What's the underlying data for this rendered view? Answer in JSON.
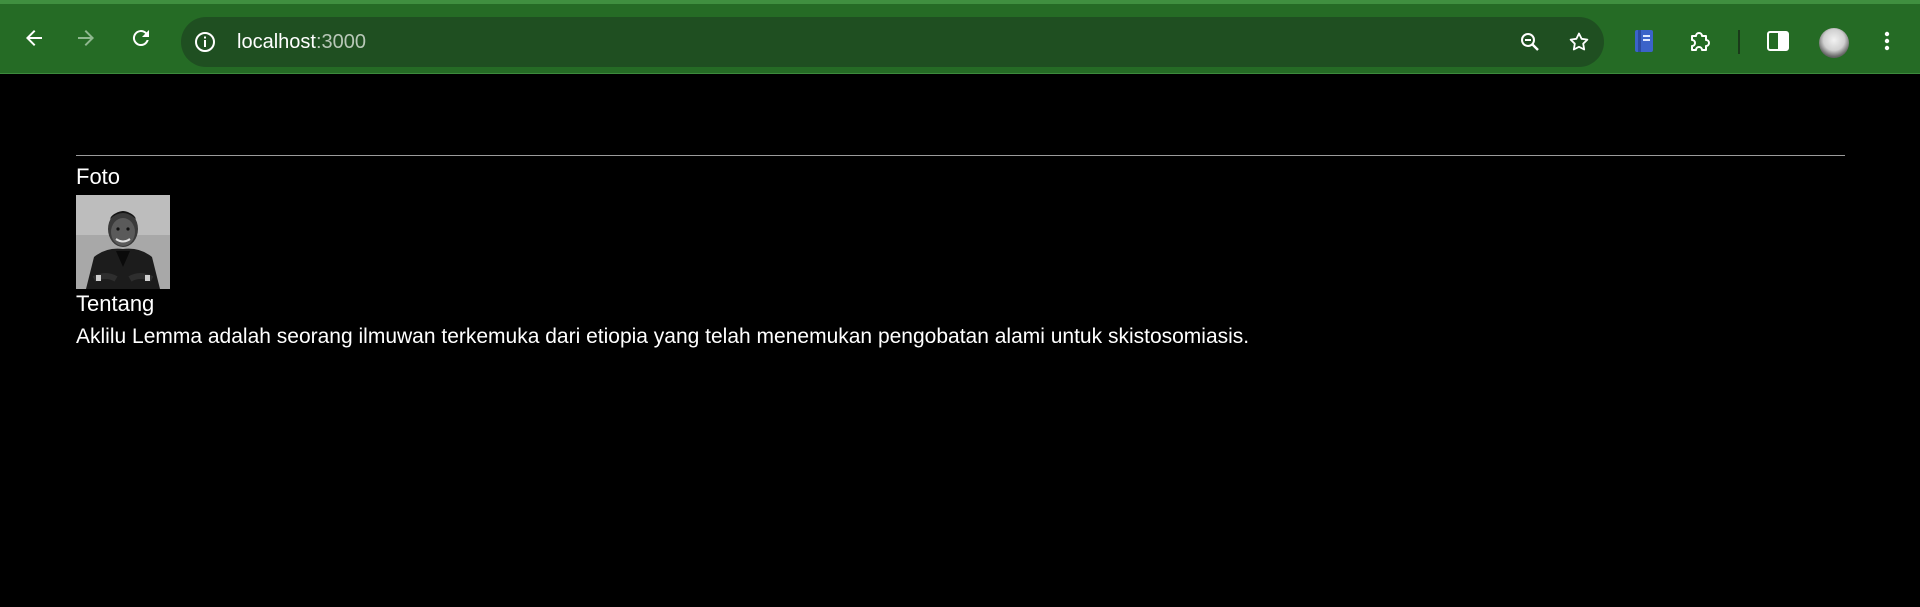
{
  "browser": {
    "url_host": "localhost",
    "url_port": ":3000",
    "toolbar_color": "#256b25",
    "icons": [
      "back-arrow-icon",
      "forward-arrow-icon",
      "reload-icon",
      "site-info-icon",
      "zoom-icon",
      "bookmark-star-icon",
      "reading-list-extension-icon",
      "extensions-puzzle-icon",
      "side-panel-icon",
      "profile-avatar",
      "more-menu-icon"
    ]
  },
  "page": {
    "photo_label": "Foto",
    "photo_alt": "Portrait photo of Aklilu Lemma",
    "about_label": "Tentang",
    "about_text": "Aklilu Lemma adalah seorang ilmuwan terkemuka dari etiopia yang telah menemukan pengobatan alami untuk skistosomiasis."
  }
}
